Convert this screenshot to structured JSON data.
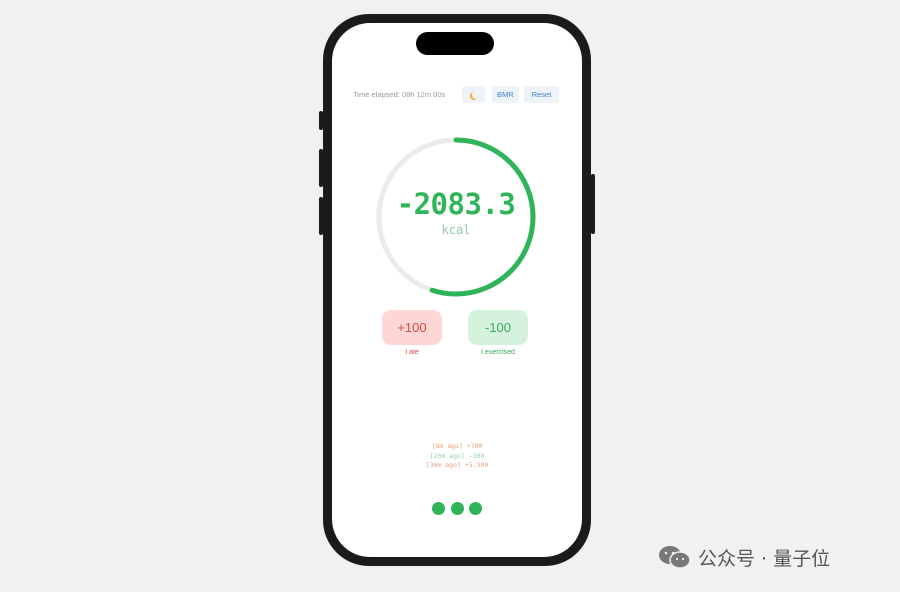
{
  "header": {
    "elapsed_text": "Time elapsed: 08h 12m 00s",
    "theme_icon": "moon-icon",
    "bmr_label": "BMR",
    "reset_label": "Reset"
  },
  "counter": {
    "value": "-2083.3",
    "unit": "kcal",
    "ring_progress": 0.55,
    "accent_color": "#2fb45a",
    "track_color": "#ebebeb"
  },
  "actions": {
    "ate_button": "+100",
    "ate_label": "I ate",
    "exercised_button": "-100",
    "exercised_label": "I exercised"
  },
  "log": [
    {
      "text": "[8m ago] +700",
      "kind": "pos"
    },
    {
      "text": "[20m ago] -300",
      "kind": "neg"
    },
    {
      "text": "[30m ago] +5,300",
      "kind": "pos"
    }
  ],
  "watermark": {
    "icon": "wechat-icon",
    "text": "公众号 · 量子位"
  }
}
